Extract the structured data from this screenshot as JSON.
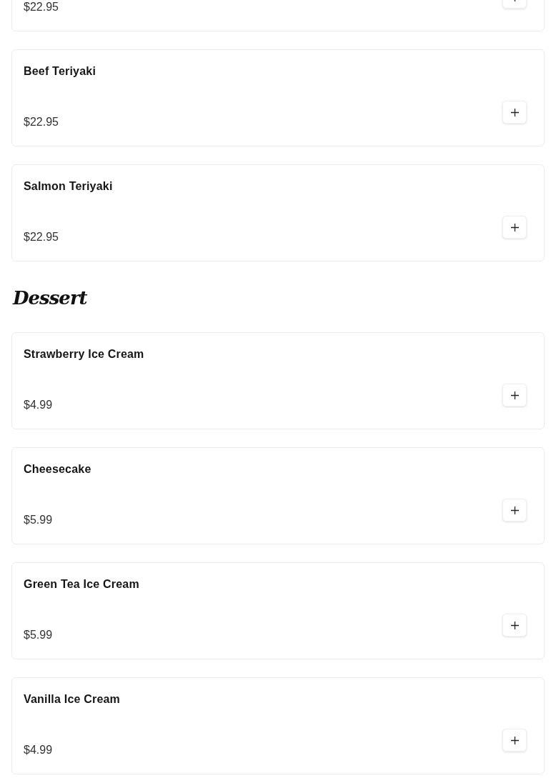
{
  "sections": [
    {
      "items": [
        {
          "price": "$22.95"
        },
        {
          "name": "Beef Teriyaki",
          "price": "$22.95"
        },
        {
          "name": "Salmon Teriyaki",
          "price": "$22.95"
        }
      ]
    },
    {
      "title": "Dessert",
      "items": [
        {
          "name": "Strawberry Ice Cream",
          "price": "$4.99"
        },
        {
          "name": "Cheesecake",
          "price": "$5.99"
        },
        {
          "name": "Green Tea Ice Cream",
          "price": "$5.99"
        },
        {
          "name": "Vanilla Ice Cream",
          "price": "$4.99"
        }
      ]
    }
  ]
}
